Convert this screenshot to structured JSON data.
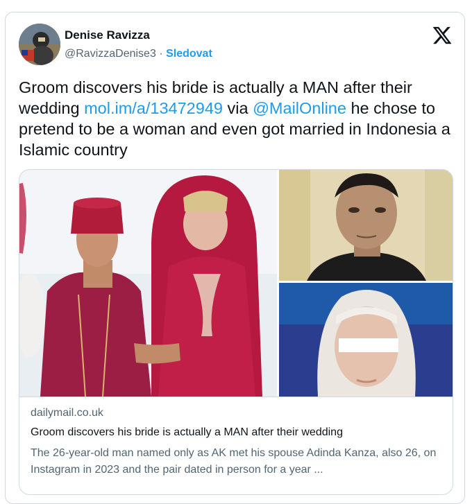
{
  "tweet": {
    "author": {
      "display_name": "Denise Ravizza",
      "handle": "@RavizzaDenise3",
      "separator": "·",
      "follow_label": "Sledovat"
    },
    "platform_icon": "x-logo-icon",
    "text": {
      "part1": "Groom discovers his bride is actually a MAN after their wedding ",
      "link1": "mol.im/a/13472949",
      "part2": " via ",
      "mention": "@MailOnline",
      "part3": " he chose to pretend to be a woman and even got married in Indonesia a Islamic country"
    },
    "media": {
      "images": [
        "wedding-couple-photo",
        "man-portrait-photo",
        "woman-hijab-blurred-photo"
      ]
    },
    "link_card": {
      "domain": "dailymail.co.uk",
      "title": "Groom discovers his bride is actually a MAN after their wedding",
      "description": "The 26-year-old man named only as AK met his spouse Adinda Kanza, also 26, on Instagram in 2023 and the pair dated in person for a year ..."
    }
  }
}
